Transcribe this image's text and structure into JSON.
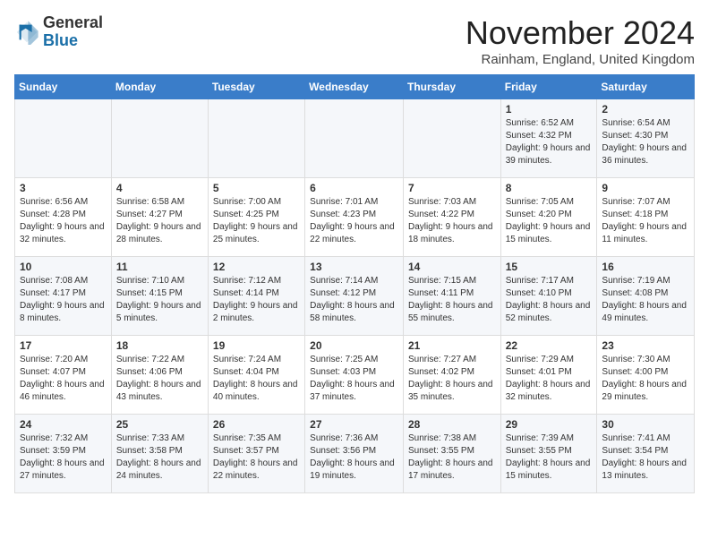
{
  "header": {
    "logo_general": "General",
    "logo_blue": "Blue",
    "month_title": "November 2024",
    "location": "Rainham, England, United Kingdom"
  },
  "weekdays": [
    "Sunday",
    "Monday",
    "Tuesday",
    "Wednesday",
    "Thursday",
    "Friday",
    "Saturday"
  ],
  "weeks": [
    [
      {
        "day": "",
        "info": ""
      },
      {
        "day": "",
        "info": ""
      },
      {
        "day": "",
        "info": ""
      },
      {
        "day": "",
        "info": ""
      },
      {
        "day": "",
        "info": ""
      },
      {
        "day": "1",
        "info": "Sunrise: 6:52 AM\nSunset: 4:32 PM\nDaylight: 9 hours and 39 minutes."
      },
      {
        "day": "2",
        "info": "Sunrise: 6:54 AM\nSunset: 4:30 PM\nDaylight: 9 hours and 36 minutes."
      }
    ],
    [
      {
        "day": "3",
        "info": "Sunrise: 6:56 AM\nSunset: 4:28 PM\nDaylight: 9 hours and 32 minutes."
      },
      {
        "day": "4",
        "info": "Sunrise: 6:58 AM\nSunset: 4:27 PM\nDaylight: 9 hours and 28 minutes."
      },
      {
        "day": "5",
        "info": "Sunrise: 7:00 AM\nSunset: 4:25 PM\nDaylight: 9 hours and 25 minutes."
      },
      {
        "day": "6",
        "info": "Sunrise: 7:01 AM\nSunset: 4:23 PM\nDaylight: 9 hours and 22 minutes."
      },
      {
        "day": "7",
        "info": "Sunrise: 7:03 AM\nSunset: 4:22 PM\nDaylight: 9 hours and 18 minutes."
      },
      {
        "day": "8",
        "info": "Sunrise: 7:05 AM\nSunset: 4:20 PM\nDaylight: 9 hours and 15 minutes."
      },
      {
        "day": "9",
        "info": "Sunrise: 7:07 AM\nSunset: 4:18 PM\nDaylight: 9 hours and 11 minutes."
      }
    ],
    [
      {
        "day": "10",
        "info": "Sunrise: 7:08 AM\nSunset: 4:17 PM\nDaylight: 9 hours and 8 minutes."
      },
      {
        "day": "11",
        "info": "Sunrise: 7:10 AM\nSunset: 4:15 PM\nDaylight: 9 hours and 5 minutes."
      },
      {
        "day": "12",
        "info": "Sunrise: 7:12 AM\nSunset: 4:14 PM\nDaylight: 9 hours and 2 minutes."
      },
      {
        "day": "13",
        "info": "Sunrise: 7:14 AM\nSunset: 4:12 PM\nDaylight: 8 hours and 58 minutes."
      },
      {
        "day": "14",
        "info": "Sunrise: 7:15 AM\nSunset: 4:11 PM\nDaylight: 8 hours and 55 minutes."
      },
      {
        "day": "15",
        "info": "Sunrise: 7:17 AM\nSunset: 4:10 PM\nDaylight: 8 hours and 52 minutes."
      },
      {
        "day": "16",
        "info": "Sunrise: 7:19 AM\nSunset: 4:08 PM\nDaylight: 8 hours and 49 minutes."
      }
    ],
    [
      {
        "day": "17",
        "info": "Sunrise: 7:20 AM\nSunset: 4:07 PM\nDaylight: 8 hours and 46 minutes."
      },
      {
        "day": "18",
        "info": "Sunrise: 7:22 AM\nSunset: 4:06 PM\nDaylight: 8 hours and 43 minutes."
      },
      {
        "day": "19",
        "info": "Sunrise: 7:24 AM\nSunset: 4:04 PM\nDaylight: 8 hours and 40 minutes."
      },
      {
        "day": "20",
        "info": "Sunrise: 7:25 AM\nSunset: 4:03 PM\nDaylight: 8 hours and 37 minutes."
      },
      {
        "day": "21",
        "info": "Sunrise: 7:27 AM\nSunset: 4:02 PM\nDaylight: 8 hours and 35 minutes."
      },
      {
        "day": "22",
        "info": "Sunrise: 7:29 AM\nSunset: 4:01 PM\nDaylight: 8 hours and 32 minutes."
      },
      {
        "day": "23",
        "info": "Sunrise: 7:30 AM\nSunset: 4:00 PM\nDaylight: 8 hours and 29 minutes."
      }
    ],
    [
      {
        "day": "24",
        "info": "Sunrise: 7:32 AM\nSunset: 3:59 PM\nDaylight: 8 hours and 27 minutes."
      },
      {
        "day": "25",
        "info": "Sunrise: 7:33 AM\nSunset: 3:58 PM\nDaylight: 8 hours and 24 minutes."
      },
      {
        "day": "26",
        "info": "Sunrise: 7:35 AM\nSunset: 3:57 PM\nDaylight: 8 hours and 22 minutes."
      },
      {
        "day": "27",
        "info": "Sunrise: 7:36 AM\nSunset: 3:56 PM\nDaylight: 8 hours and 19 minutes."
      },
      {
        "day": "28",
        "info": "Sunrise: 7:38 AM\nSunset: 3:55 PM\nDaylight: 8 hours and 17 minutes."
      },
      {
        "day": "29",
        "info": "Sunrise: 7:39 AM\nSunset: 3:55 PM\nDaylight: 8 hours and 15 minutes."
      },
      {
        "day": "30",
        "info": "Sunrise: 7:41 AM\nSunset: 3:54 PM\nDaylight: 8 hours and 13 minutes."
      }
    ]
  ]
}
